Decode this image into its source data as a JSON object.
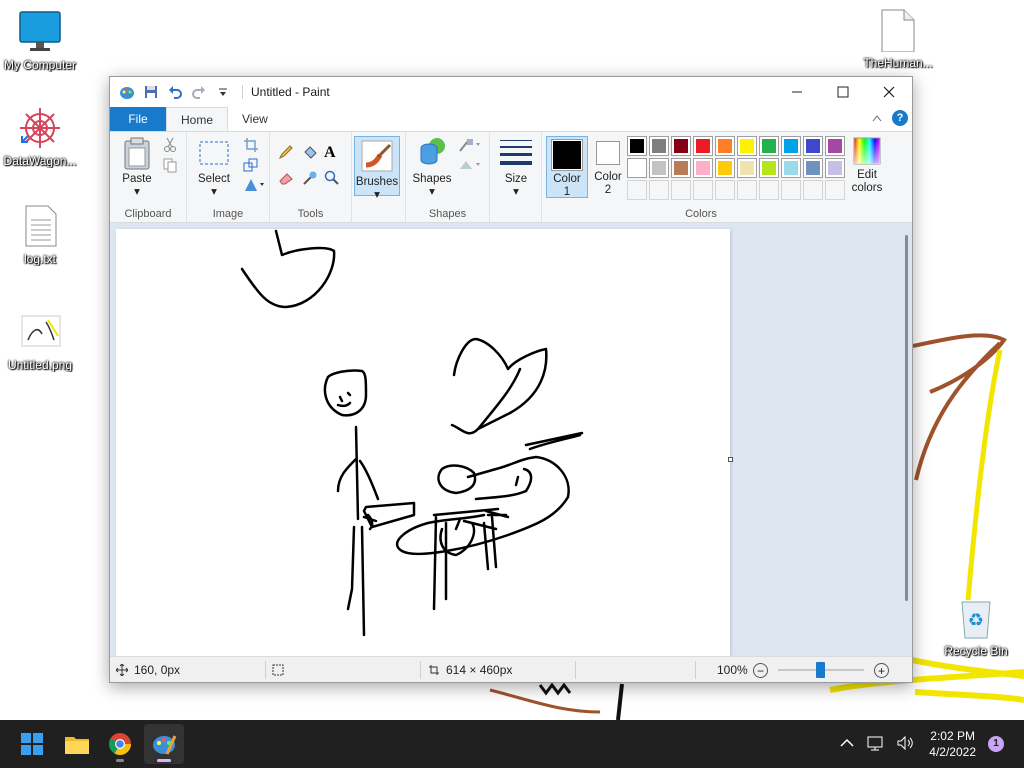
{
  "desktop": {
    "icons": [
      {
        "label": "My Computer"
      },
      {
        "label": "DataWagon..."
      },
      {
        "label": "log.txt"
      },
      {
        "label": "Untitled.png"
      },
      {
        "label": "TheHuman..."
      },
      {
        "label": "Recycle Bin"
      }
    ]
  },
  "window": {
    "title": "Untitled - Paint",
    "tabs": {
      "file": "File",
      "home": "Home",
      "view": "View"
    },
    "help": "?"
  },
  "ribbon": {
    "clipboard": {
      "paste": "Paste",
      "label": "Clipboard"
    },
    "image": {
      "select": "Select",
      "label": "Image"
    },
    "tools": {
      "label": "Tools",
      "text_glyph": "A"
    },
    "brushes": {
      "label": "Brushes"
    },
    "shapes": {
      "shapes": "Shapes",
      "label": "Shapes"
    },
    "size": {
      "label": "Size"
    },
    "colors": {
      "color1_label": "Color",
      "color1_num": "1",
      "color2_label": "Color",
      "color2_num": "2",
      "edit_label": "Edit",
      "edit_label2": "colors",
      "label": "Colors",
      "color1": "#000000",
      "color2": "#ffffff",
      "row1": [
        "#000000",
        "#7f7f7f",
        "#880015",
        "#ed1c24",
        "#ff7f27",
        "#fff200",
        "#22b14c",
        "#00a2e8",
        "#3f48cc",
        "#a349a4"
      ],
      "row2": [
        "#ffffff",
        "#c3c3c3",
        "#b97a57",
        "#ffaec9",
        "#ffc90e",
        "#efe4b0",
        "#b5e61d",
        "#99d9ea",
        "#7092be",
        "#c8bfe7"
      ]
    }
  },
  "status": {
    "cursor_pos": "160, 0px",
    "canvas_size": "614 × 460px",
    "zoom": "100%"
  },
  "taskbar": {
    "time": "2:02 PM",
    "date": "4/2/2022",
    "notifications": "1"
  }
}
